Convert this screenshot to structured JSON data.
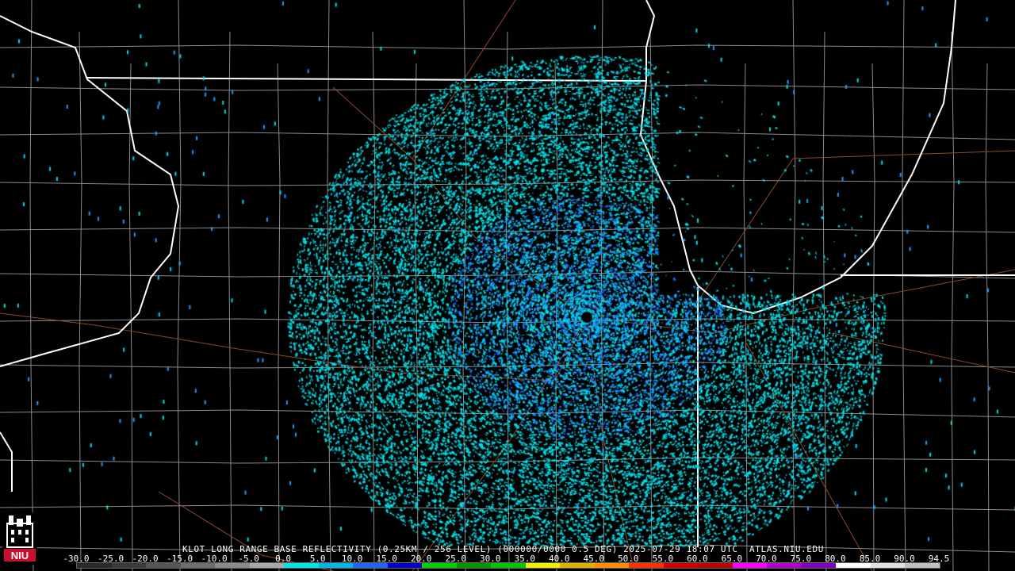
{
  "product": {
    "caption": "KLOT LONG RANGE BASE REFLECTIVITY (0.25KM / 256 LEVEL) (000000/0000 0.5 DEG) 2025-07-29 18:07 UTC  ATLAS.NIU.EDU"
  },
  "logo": {
    "text": "NIU",
    "color": "#c8102e"
  },
  "colorbar": {
    "labels": [
      "-30.0",
      "-25.0",
      "-20.0",
      "-15.0",
      "-10.0",
      "-5.0",
      "0.0",
      "5.0",
      "10.0",
      "15.0",
      "20.0",
      "25.0",
      "30.0",
      "35.0",
      "40.0",
      "45.0",
      "50.0",
      "55.0",
      "60.0",
      "65.0",
      "70.0",
      "75.0",
      "80.0",
      "85.0",
      "90.0",
      "94.5"
    ],
    "colors": [
      "#2a2a2a",
      "#3a3a3a",
      "#555555",
      "#6e6e6e",
      "#8a8a8a",
      "#a8a8a8",
      "#00e5e5",
      "#00b8e8",
      "#1e64ff",
      "#0000c8",
      "#00d000",
      "#009600",
      "#00c800",
      "#f0f000",
      "#e0b000",
      "#ff8c00",
      "#ff3000",
      "#d00000",
      "#c00000",
      "#ff00ff",
      "#b000d0",
      "#8000c0",
      "#ffffff",
      "#e0e0e0",
      "#c0c0c0"
    ]
  },
  "map_layers": {
    "state_line_color": "#ffffff",
    "county_line_color": "#8c8c8c",
    "road_color": "#8b4a2a",
    "echo_colors": [
      "#00e0e6",
      "#00c8e0",
      "#1ea0ff",
      "#1464e6"
    ]
  }
}
